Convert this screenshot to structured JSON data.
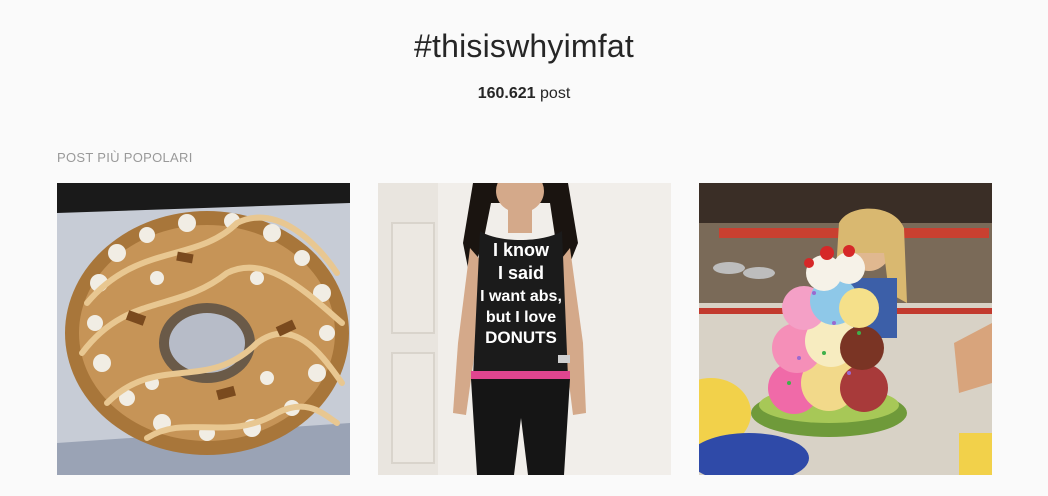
{
  "header": {
    "hashtag": "#thisiswhyimfat",
    "post_count": "160.621",
    "post_label": "post"
  },
  "section": {
    "title": "POST PIÙ POPOLARI"
  },
  "posts": [
    {
      "icon": "donut-photo",
      "shirt_text": ""
    },
    {
      "icon": "person-tshirt-photo",
      "shirt_text": [
        "I know",
        "I said",
        "I want abs,",
        "but I love",
        "DONUTS"
      ]
    },
    {
      "icon": "ice-cream-sundae-photo",
      "shirt_text": ""
    }
  ],
  "colors": {
    "background": "#fafafa",
    "text": "#262626",
    "muted": "#999999"
  }
}
